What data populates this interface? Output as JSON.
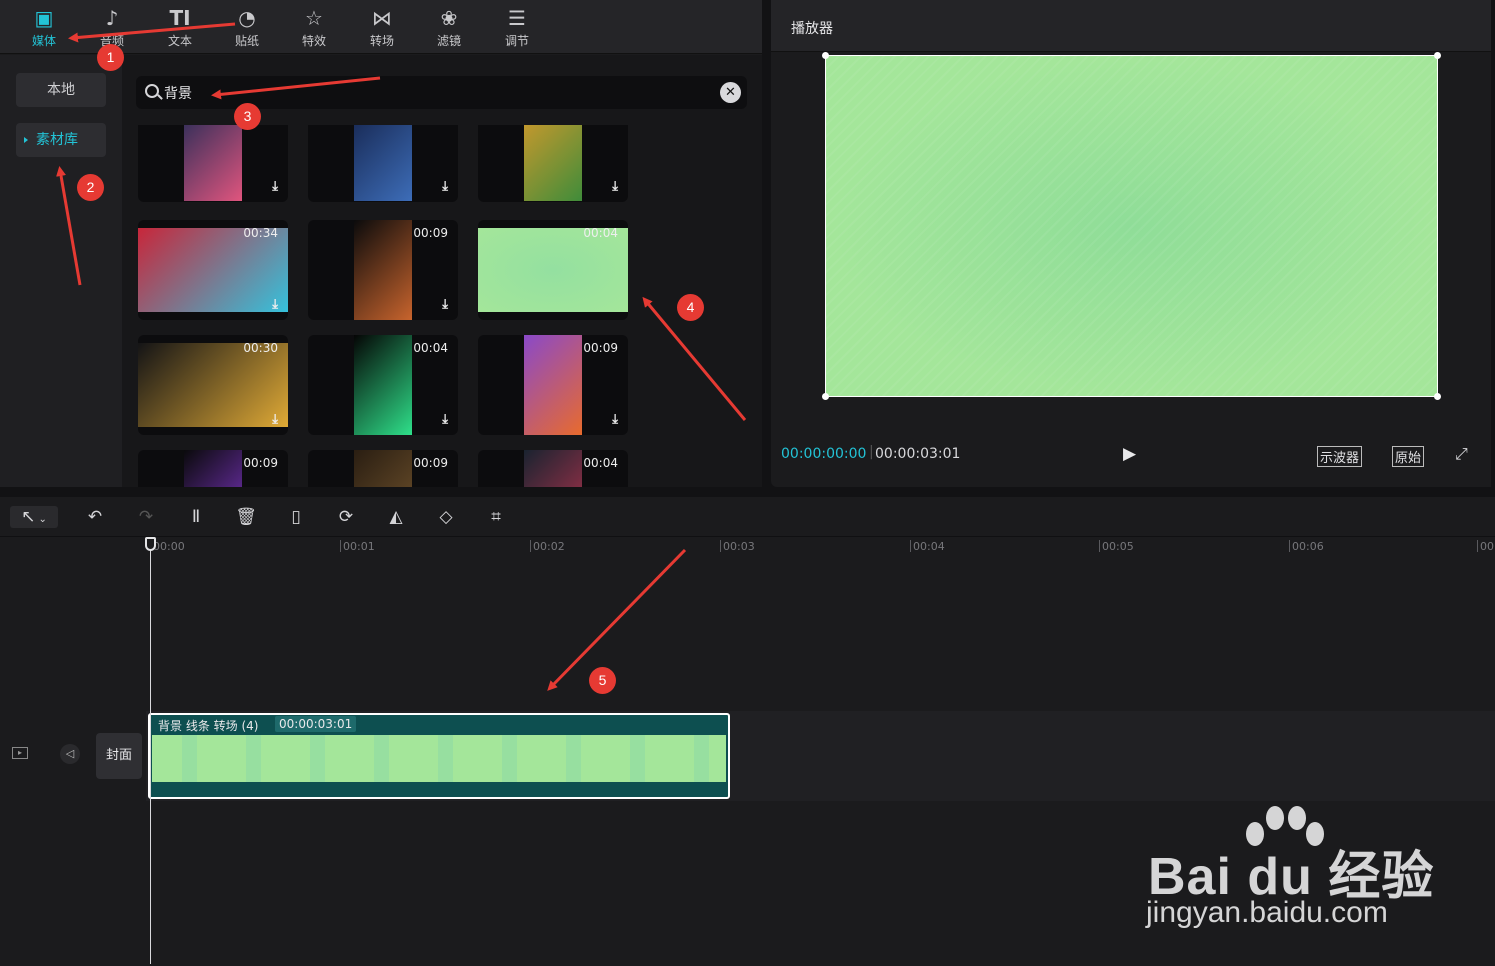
{
  "toolbar": {
    "tabs": [
      {
        "label": "媒体",
        "icon": "play-square-icon"
      },
      {
        "label": "音频",
        "icon": "music-icon"
      },
      {
        "label": "文本",
        "icon": "text-icon"
      },
      {
        "label": "贴纸",
        "icon": "sticker-icon"
      },
      {
        "label": "特效",
        "icon": "sparkle-icon"
      },
      {
        "label": "转场",
        "icon": "transition-icon"
      },
      {
        "label": "滤镜",
        "icon": "filter-icon"
      },
      {
        "label": "调节",
        "icon": "sliders-icon"
      }
    ],
    "active_tab": "媒体"
  },
  "sidebar": {
    "items": [
      {
        "label": "本地"
      },
      {
        "label": "素材库"
      }
    ],
    "active": "素材库"
  },
  "search": {
    "value": "背景",
    "clear_label": "✕"
  },
  "library": {
    "cards": [
      {
        "duration": "",
        "download": "⤓",
        "colors": [
          "#1e2a55",
          "#e0557e"
        ]
      },
      {
        "duration": "",
        "download": "⤓",
        "colors": [
          "#14224a",
          "#3d6db8"
        ]
      },
      {
        "duration": "",
        "download": "⤓",
        "colors": [
          "#d99a2b",
          "#3f8c3a"
        ]
      },
      {
        "duration": "00:34",
        "download": "⤓",
        "colors": [
          "#c8263a",
          "#35c2dc"
        ]
      },
      {
        "duration": "00:09",
        "download": "⤓",
        "colors": [
          "#0b0b0c",
          "#c8642d"
        ]
      },
      {
        "duration": "00:04",
        "download": "",
        "colors": [
          "#a4e69a",
          "#a4e69a"
        ]
      },
      {
        "duration": "00:30",
        "download": "⤓",
        "colors": [
          "#141416",
          "#e0aa36"
        ]
      },
      {
        "duration": "00:04",
        "download": "⤓",
        "colors": [
          "#050505",
          "#2fe08a"
        ]
      },
      {
        "duration": "00:09",
        "download": "⤓",
        "colors": [
          "#8a49c9",
          "#e86b2d"
        ]
      },
      {
        "duration": "00:09",
        "download": "",
        "colors": [
          "#0a0a0c",
          "#8a3ad8"
        ]
      },
      {
        "duration": "00:09",
        "download": "",
        "colors": [
          "#2a1e12",
          "#7a5a30"
        ]
      },
      {
        "duration": "00:04",
        "download": "",
        "colors": [
          "#1a2330",
          "#c23550"
        ]
      }
    ]
  },
  "player": {
    "title": "播放器",
    "current_time": "00:00:00:00",
    "total_time": "00:00:03:01",
    "play_label": "▶",
    "scope_button": "示波器",
    "original_button": "原始",
    "fullscreen_label": "⤢",
    "preview_color": "#a4e69a"
  },
  "timeline": {
    "tools": [
      {
        "icon": "select-cursor-icon",
        "glyph": "↖"
      },
      {
        "icon": "undo-icon",
        "glyph": "↶"
      },
      {
        "icon": "redo-icon",
        "glyph": "↷"
      },
      {
        "icon": "split-icon",
        "glyph": "Ⅱ"
      },
      {
        "icon": "delete-icon",
        "glyph": "🗑"
      },
      {
        "icon": "freeze-icon",
        "glyph": "▯"
      },
      {
        "icon": "reverse-icon",
        "glyph": "⟳"
      },
      {
        "icon": "mirror-icon",
        "glyph": "◭"
      },
      {
        "icon": "rotate-icon",
        "glyph": "◇"
      },
      {
        "icon": "crop-icon",
        "glyph": "⌗"
      }
    ],
    "ruler_labels": [
      "00:00",
      "00:01",
      "00:02",
      "00:03",
      "00:04",
      "00:05",
      "00:06",
      "00"
    ],
    "clip": {
      "label": "背景 线条 转场 (4)",
      "duration": "00:00:03:01"
    },
    "cover_label": "封面"
  },
  "annotations": [
    "1",
    "2",
    "3",
    "4",
    "5"
  ],
  "watermark": {
    "brand": "Bai du 经验",
    "url": "jingyan.baidu.com"
  },
  "colors": {
    "accent": "#23c3d6",
    "annotation": "#e63a33",
    "clip_bg": "#0d4f50"
  }
}
